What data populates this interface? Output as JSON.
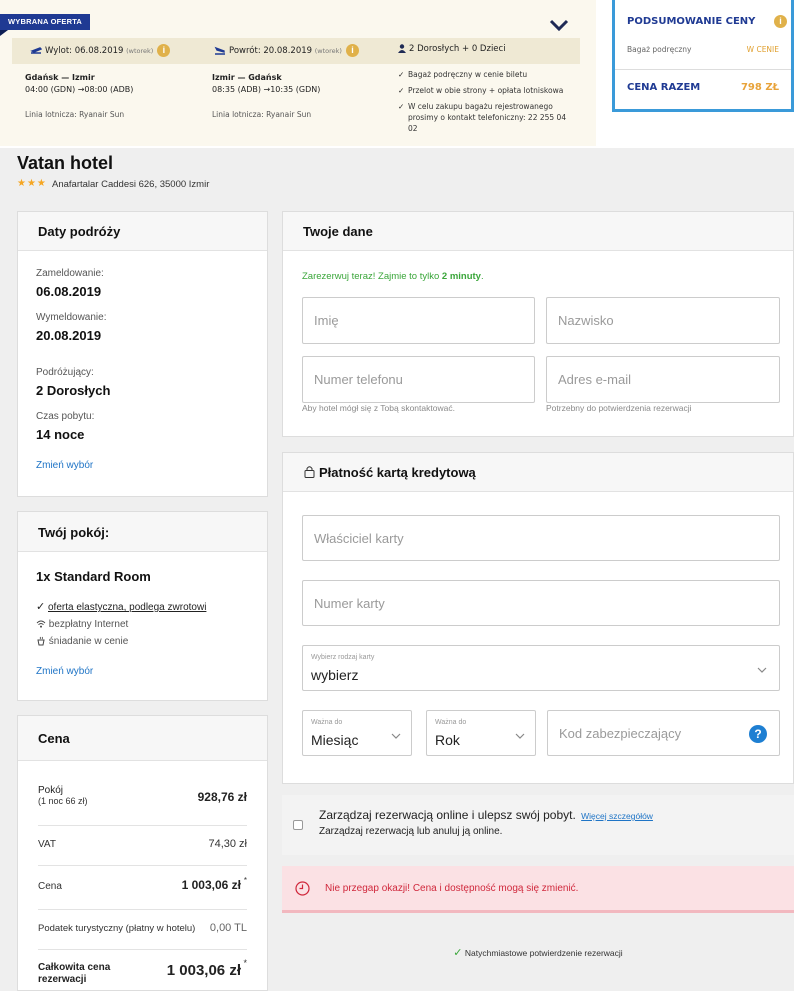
{
  "flight": {
    "tag": "WYBRANA OFERTA",
    "outbound_label": "Wylot: 06.08.2019",
    "outbound_day": "(wtorek)",
    "return_label": "Powrót: 20.08.2019",
    "return_day": "(wtorek)",
    "passengers": "2 Dorosłych + 0 Dzieci",
    "out_route": "Gdańsk — Izmir",
    "out_times": "04:00 (GDN) →08:00 (ADB)",
    "out_airline": "Linia lotnicza: Ryanair Sun",
    "ret_route": "Izmir — Gdańsk",
    "ret_times": "08:35 (ADB) →10:35 (GDN)",
    "ret_airline": "Linia lotnicza: Ryanair Sun",
    "checks": [
      "Bagaż podręczny w cenie biletu",
      "Przelot w obie strony + opłata lotniskowa",
      "W celu zakupu bagażu rejestrowanego",
      "prosimy o kontakt telefoniczny: 22 255 04",
      "02"
    ]
  },
  "summary": {
    "title": "PODSUMOWANIE CENY",
    "baggage_label": "Bagaż podręczny",
    "baggage_value": "W CENIE",
    "total_label": "CENA RAZEM",
    "total_value": "798 ZŁ"
  },
  "hotel": {
    "name": "Vatan hotel",
    "stars": "★★★",
    "address": "Anafartalar Caddesi 626, 35000 Izmir"
  },
  "trip": {
    "title": "Daty podróży",
    "checkin_label": "Zameldowanie:",
    "checkin_value": "06.08.2019",
    "checkout_label": "Wymeldowanie:",
    "checkout_value": "20.08.2019",
    "travelers_label": "Podróżujący:",
    "travelers_value": "2 Dorosłych",
    "stay_label": "Czas pobytu:",
    "stay_value": "14 noce",
    "change_link": "Zmień wybór"
  },
  "room": {
    "title": "Twój pokój:",
    "name": "1x Standard Room",
    "feature_flexible": "oferta elastyczna, podlega zwrotowi",
    "feature_internet": "bezpłatny Internet",
    "feature_breakfast": "śniadanie w cenie",
    "change_link": "Zmień wybór"
  },
  "price": {
    "title": "Cena",
    "room_label": "Pokój",
    "room_sub": "(1 noc 66 zł)",
    "room_value": "928,76 zł",
    "vat_label": "VAT",
    "vat_value": "74,30 zł",
    "price_label": "Cena",
    "price_value": "1 003,06 zł",
    "tax_label": "Podatek turystyczny (płatny w hotelu)",
    "tax_value": "0,00 TL",
    "total_label_1": "Całkowita cena",
    "total_label_2": "rezerwacji",
    "total_value": "1 003,06 zł"
  },
  "details": {
    "title": "Twoje dane",
    "promo_text": "Zarezerwuj teraz! Zajmie to tylko ",
    "promo_bold": "2 minuty",
    "promo_end": ".",
    "first_name_ph": "Imię",
    "last_name_ph": "Nazwisko",
    "phone_ph": "Numer telefonu",
    "email_ph": "Adres e-mail",
    "phone_hint": "Aby hotel mógł się z Tobą skontaktować.",
    "email_hint": "Potrzebny do potwierdzenia rezerwacji"
  },
  "payment": {
    "title": "Płatność kartą kredytową",
    "holder_ph": "Właściciel karty",
    "number_ph": "Numer karty",
    "card_type_label": "Wybierz rodzaj karty",
    "card_type_value": "wybierz",
    "valid_label": "Ważna do",
    "month_value": "Miesiąc",
    "year_value": "Rok",
    "cvv_ph": "Kod zabezpieczający",
    "help": "?"
  },
  "manage": {
    "title": "Zarządzaj rezerwacją online i ulepsz swój pobyt.",
    "more_link": "Więcej szczegółów",
    "subtitle": "Zarządzaj rezerwacją lub anuluj ją online."
  },
  "alert": {
    "text": "Nie przegap okazji! Cena i dostępność mogą się zmienić."
  },
  "confirm": {
    "text": "Natychmiastowe potwierdzenie rezerwacji"
  },
  "colors": {
    "brand": "#1f3a93",
    "accent_border": "#3a9ad9",
    "price_orange": "#e8a33a",
    "link": "#1e74c6",
    "success": "#3aa63a",
    "alert_red": "#d0283c"
  },
  "icons": [
    "plane-takeoff-icon",
    "plane-landing-icon",
    "person-icon",
    "info-icon",
    "chevron-down-icon",
    "check-icon",
    "wifi-icon",
    "breakfast-icon",
    "lock-icon",
    "clock-icon",
    "help-icon"
  ]
}
